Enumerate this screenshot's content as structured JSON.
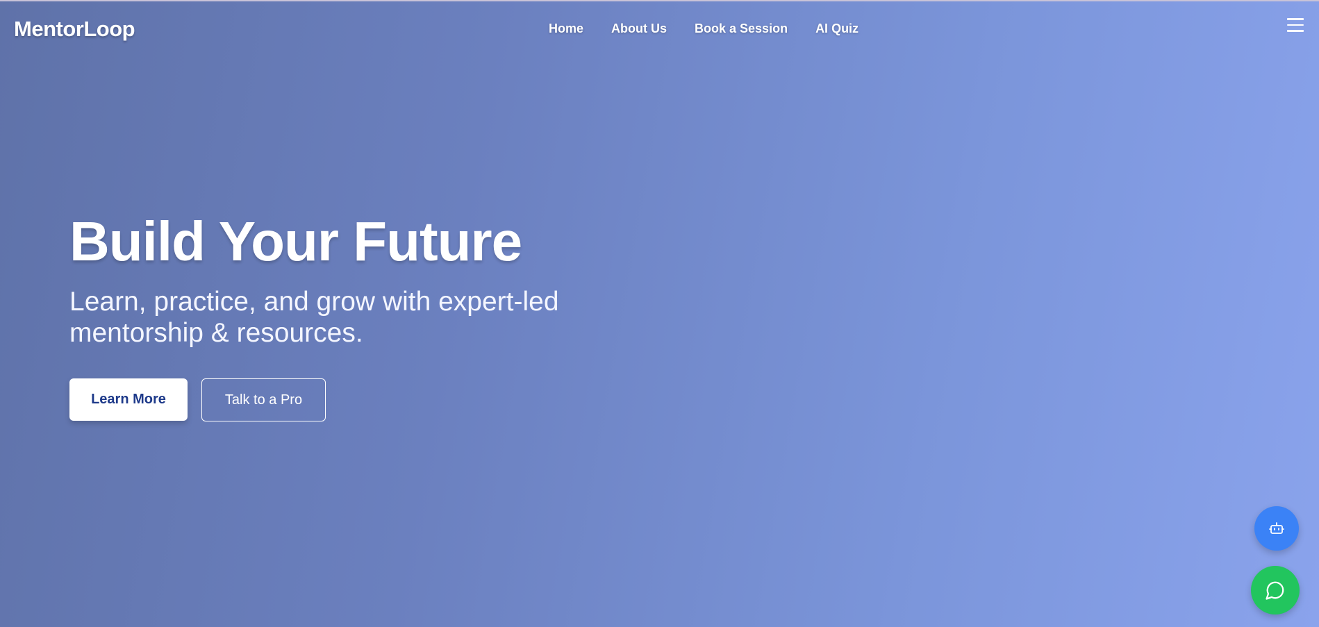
{
  "header": {
    "logo": "MentorLoop",
    "nav": [
      {
        "label": "Home"
      },
      {
        "label": "About Us"
      },
      {
        "label": "Book a Session"
      },
      {
        "label": "AI Quiz"
      }
    ],
    "menu_icon": "hamburger-menu-icon"
  },
  "hero": {
    "title": "Build Your Future",
    "subtitle": "Learn, practice, and grow with expert-led mentorship & resources.",
    "primary_button": "Learn More",
    "secondary_button": "Talk to a Pro"
  },
  "floating_buttons": {
    "bot_icon": "robot-icon",
    "bot_color": "#3b82f6",
    "chat_icon": "chat-bubble-icon",
    "chat_color": "#22c55e"
  },
  "colors": {
    "gradient_start": "#5f72a9",
    "gradient_end": "#8aa3ec",
    "primary_button_text": "#1e3a8a"
  }
}
